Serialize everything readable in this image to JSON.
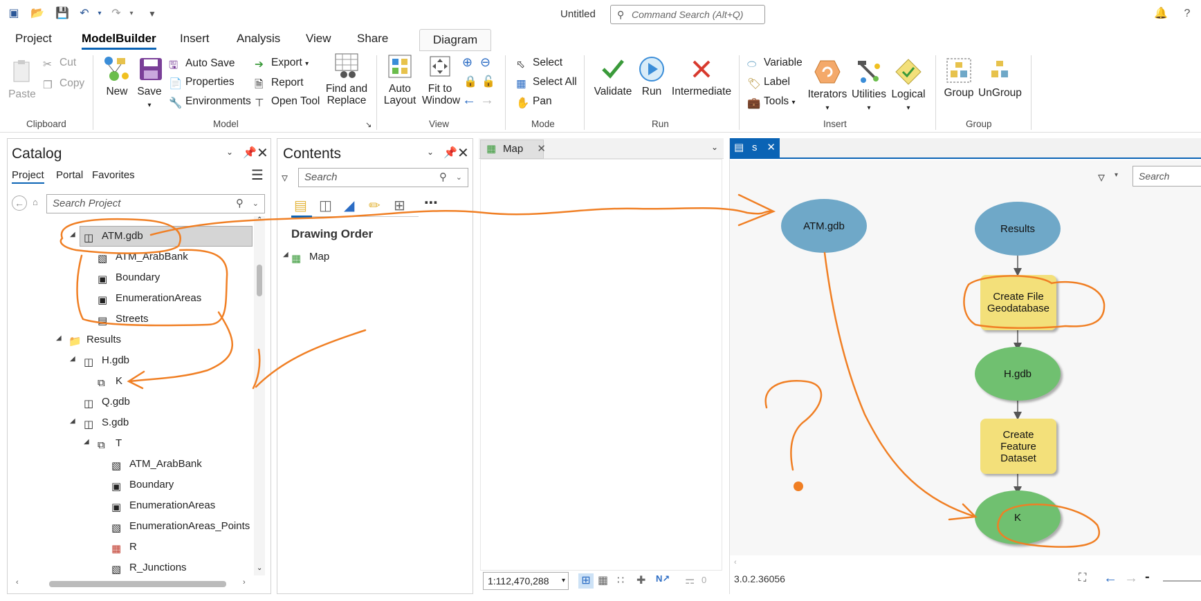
{
  "title_bar": {
    "doc_title": "Untitled",
    "command_search_placeholder": "Command Search (Alt+Q)"
  },
  "ribbon_tabs": [
    "Project",
    "ModelBuilder",
    "Insert",
    "Analysis",
    "View",
    "Share"
  ],
  "active_tab": "ModelBuilder",
  "contextual_tab": "Diagram",
  "ribbon": {
    "clipboard": {
      "paste": "Paste",
      "cut": "Cut",
      "copy": "Copy",
      "label": "Clipboard"
    },
    "model": {
      "new": "New",
      "save": "Save",
      "auto_save": "Auto Save",
      "properties": "Properties",
      "environments": "Environments",
      "export": "Export",
      "report": "Report",
      "open_tool": "Open Tool",
      "find_replace_1": "Find and",
      "find_replace_2": "Replace",
      "label": "Model"
    },
    "view": {
      "auto_layout_1": "Auto",
      "auto_layout_2": "Layout",
      "fit_window_1": "Fit to",
      "fit_window_2": "Window",
      "label": "View"
    },
    "mode": {
      "select": "Select",
      "select_all": "Select All",
      "pan": "Pan",
      "label": "Mode"
    },
    "run": {
      "validate": "Validate",
      "run": "Run",
      "intermediate": "Intermediate",
      "label": "Run"
    },
    "insert": {
      "variable": "Variable",
      "label_btn": "Label",
      "tools": "Tools",
      "iterators": "Iterators",
      "utilities": "Utilities",
      "logical": "Logical",
      "label": "Insert"
    },
    "group": {
      "group": "Group",
      "ungroup": "UnGroup",
      "label": "Group"
    }
  },
  "catalog": {
    "title": "Catalog",
    "tabs": [
      "Project",
      "Portal",
      "Favorites"
    ],
    "search_placeholder": "Search Project",
    "tree": [
      {
        "label": "ATM.gdb",
        "icon": "gdb-icon"
      },
      {
        "label": "ATM_ArabBank",
        "icon": "point-fc-icon"
      },
      {
        "label": "Boundary",
        "icon": "polygon-fc-icon"
      },
      {
        "label": "EnumerationAreas",
        "icon": "polygon-fc-icon"
      },
      {
        "label": "Streets",
        "icon": "line-fc-icon"
      },
      {
        "label": "Results",
        "icon": "folder-icon"
      },
      {
        "label": "H.gdb",
        "icon": "gdb-icon"
      },
      {
        "label": "K",
        "icon": "feature-dataset-icon"
      },
      {
        "label": "Q.gdb",
        "icon": "gdb-icon"
      },
      {
        "label": "S.gdb",
        "icon": "gdb-icon"
      },
      {
        "label": "T",
        "icon": "feature-dataset-icon"
      },
      {
        "label": "ATM_ArabBank",
        "icon": "point-fc-icon"
      },
      {
        "label": "Boundary",
        "icon": "polygon-fc-icon"
      },
      {
        "label": "EnumerationAreas",
        "icon": "polygon-fc-icon"
      },
      {
        "label": "EnumerationAreas_Points",
        "icon": "point-fc-icon"
      },
      {
        "label": "R",
        "icon": "raster-icon"
      },
      {
        "label": "R_Junctions",
        "icon": "point-fc-icon"
      }
    ]
  },
  "contents": {
    "title": "Contents",
    "search_placeholder": "Search",
    "drawing_order": "Drawing Order",
    "map_item": "Map"
  },
  "map_view": {
    "tab_label": "Map",
    "scale": "1:112,470,288",
    "selected_count": "0"
  },
  "model_view": {
    "tab_label": "s",
    "search_placeholder": "Search",
    "version": "3.0.2.36056",
    "nodes": {
      "atm": "ATM.gdb",
      "results": "Results",
      "create_fgdb": "Create File Geodatabase",
      "hgdb": "H.gdb",
      "create_fd": "Create Feature Dataset",
      "k": "K"
    },
    "colors": {
      "blue_var": "#6fa8c8",
      "yellow_tool": "#f3e07a",
      "green_output": "#70c070",
      "annotation": "#f07f24",
      "accent": "#0a63b5"
    }
  }
}
